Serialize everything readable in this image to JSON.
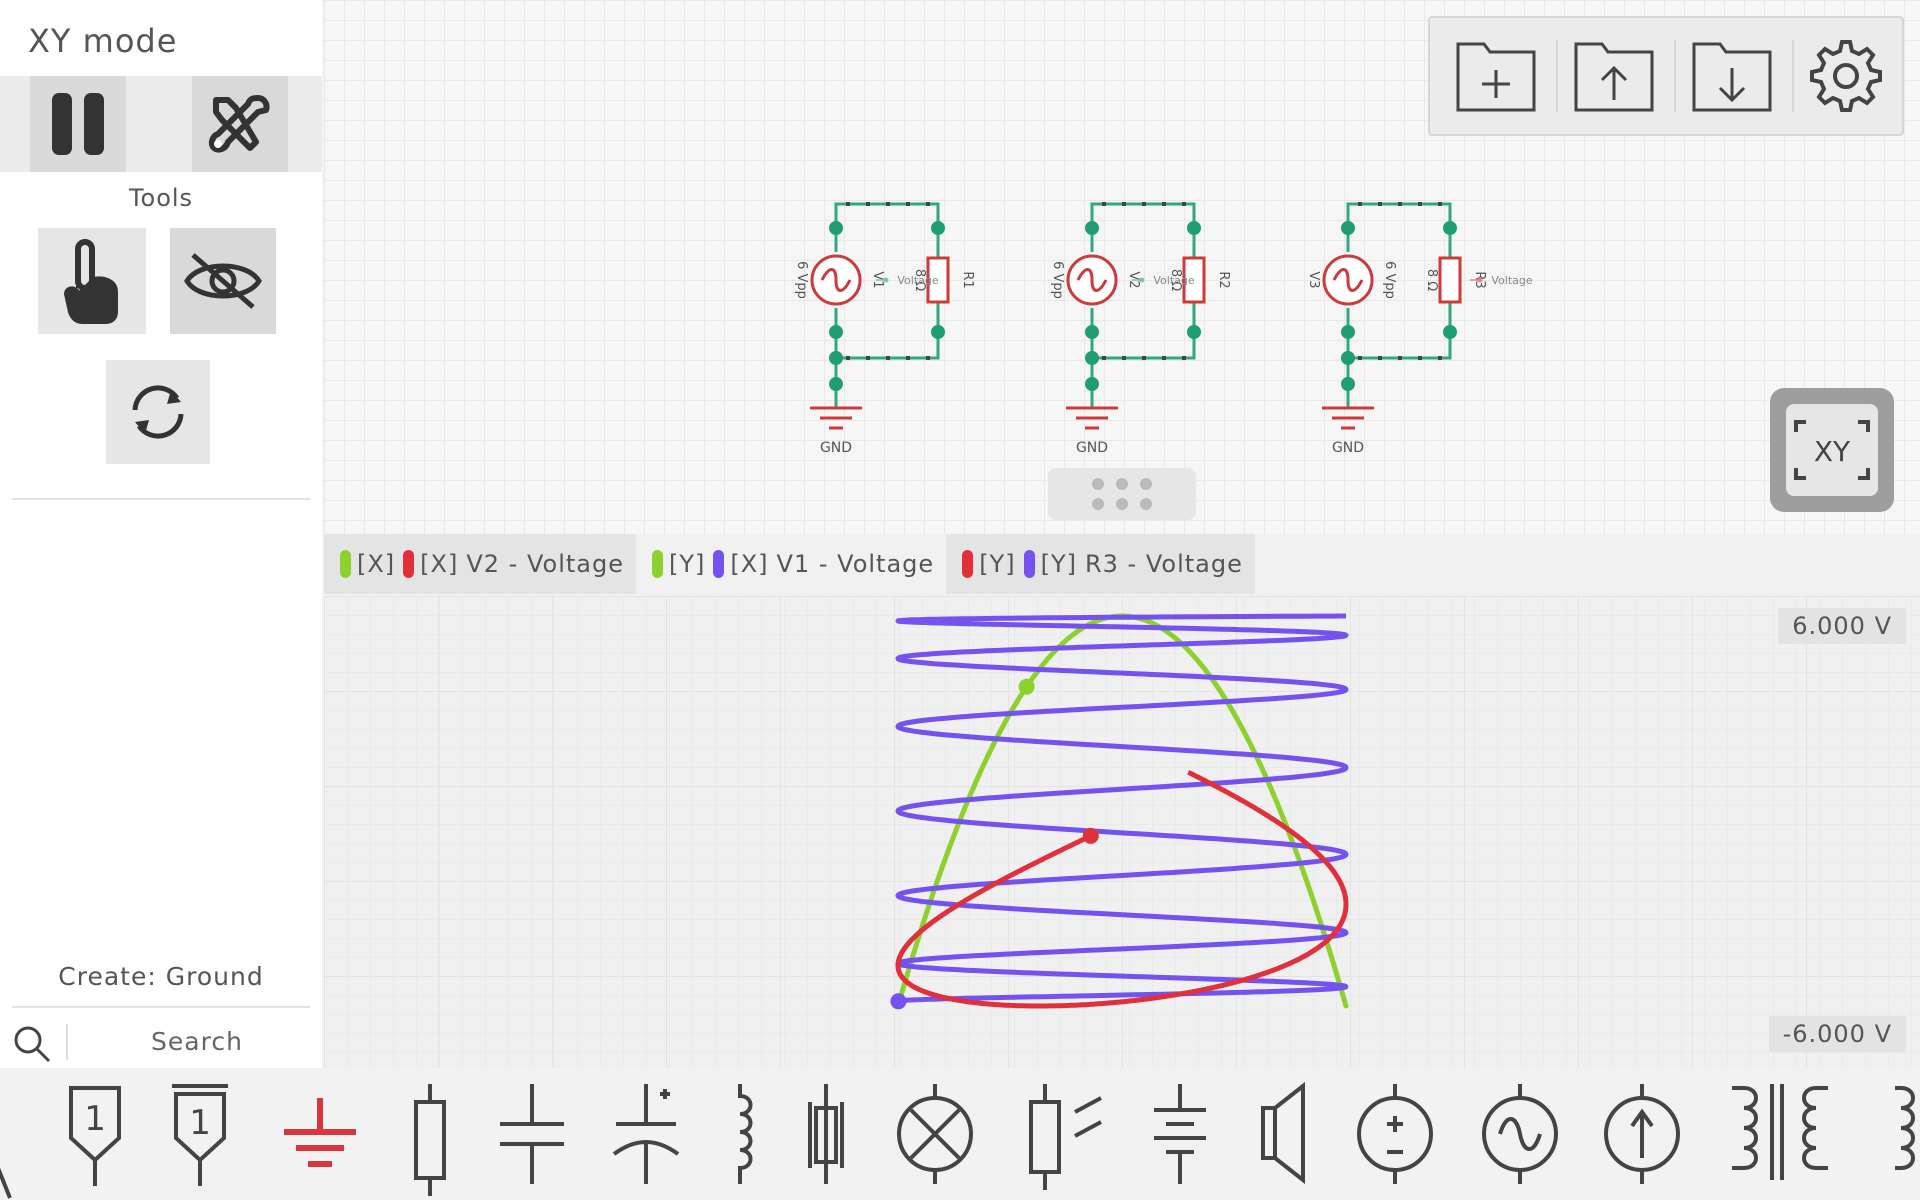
{
  "app": {
    "title": "XY mode"
  },
  "sidebar": {
    "tools_label": "Tools",
    "create_label": "Create: Ground",
    "search_placeholder": "Search"
  },
  "circuit": {
    "circuits": [
      {
        "source": "V1",
        "source_value": "6 Vpp",
        "resistor": "R1",
        "resistor_value": "8 Ω",
        "probe": "Voltage",
        "ground": "GND"
      },
      {
        "source": "V2",
        "source_value": "6 Vpp",
        "resistor": "R2",
        "resistor_value": "8 Ω",
        "probe": "Voltage",
        "ground": "GND"
      },
      {
        "source": "V3",
        "source_value": "6 Vpp",
        "resistor": "R3",
        "resistor_value": "8 Ω",
        "probe": "Voltage",
        "ground": "GND"
      }
    ]
  },
  "xy_button": {
    "label": "XY"
  },
  "scope": {
    "tabs": [
      {
        "y_tag": "[X]",
        "x_tag": "[X]",
        "name": "V2 - Voltage",
        "y_color": "#8cd12e",
        "x_color": "#e0303a"
      },
      {
        "y_tag": "[Y]",
        "x_tag": "[X]",
        "name": "V1 - Voltage",
        "y_color": "#8cd12e",
        "x_color": "#7452f0"
      },
      {
        "y_tag": "[Y]",
        "x_tag": "[Y]",
        "name": "R3 - Voltage",
        "y_color": "#e0303a",
        "x_color": "#7452f0"
      }
    ],
    "y_max_label": "6.000 V",
    "y_min_label": "-6.000 V"
  },
  "chart_data": {
    "type": "line",
    "ylim": [
      -6,
      6
    ],
    "series": [
      {
        "color": "#8cd12e",
        "x_freq": 1,
        "y_freq": 2,
        "x_amp": 1.0,
        "y_amp": 1.0
      },
      {
        "color": "#7452f0",
        "x_freq": 1,
        "y_freq": 7,
        "x_amp": 1.0,
        "y_amp": 1.0
      },
      {
        "color": "#e0303a",
        "x_freq": 1,
        "y_freq": 1,
        "x_amp": 1.0,
        "y_amp": 1.0
      }
    ]
  },
  "palette": {
    "items": [
      "triangle-source-icon",
      "label-1-icon",
      "label-1-bar-icon",
      "ground-icon",
      "resistor-icon",
      "capacitor-icon",
      "polarized-capacitor-icon",
      "inductor-icon",
      "crystal-icon",
      "lamp-icon",
      "photoresistor-icon",
      "battery-icon",
      "speaker-icon",
      "dc-voltage-source-icon",
      "ac-voltage-source-icon",
      "current-source-icon",
      "transformer-icon",
      "inductor-partial-icon"
    ]
  },
  "colors": {
    "accent_green": "#8cd12e",
    "accent_purple": "#7452f0",
    "accent_red": "#e0303a",
    "wire": "#2fa884",
    "node": "#1f9e74",
    "component": "#cc3a3a"
  }
}
